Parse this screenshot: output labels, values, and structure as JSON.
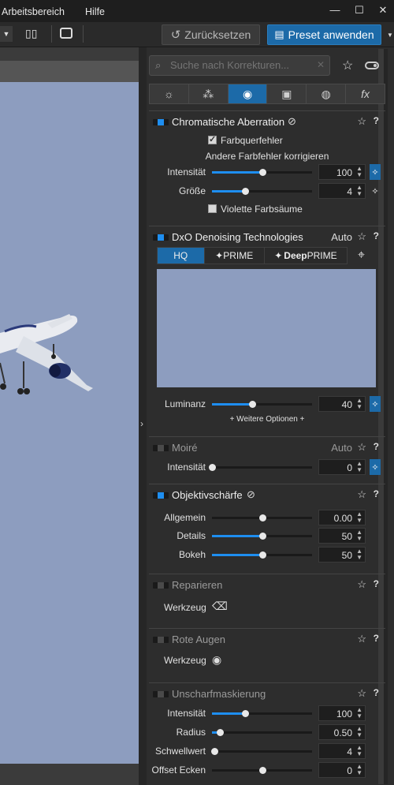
{
  "menubar": {
    "items": [
      "Arbeitsbereich",
      "Hilfe"
    ],
    "win": [
      "—",
      "☐",
      "✕"
    ]
  },
  "toolbar": {
    "reset_label": "Zurücksetzen",
    "preset_label": "Preset anwenden"
  },
  "search": {
    "placeholder": "Suche nach Korrekturen..."
  },
  "tabs": [
    "☼",
    "⁂",
    "◉",
    "▣",
    "◍",
    "fx"
  ],
  "sections": {
    "ca": {
      "title": "Chromatische Aberration",
      "checkbox1": "Farbquerfehler",
      "subheading": "Andere Farbfehler korrigieren",
      "rows": [
        {
          "label": "Intensität",
          "value": "100",
          "level": 0.5
        },
        {
          "label": "Größe",
          "value": "4",
          "level": 0.33
        }
      ],
      "checkbox2": "Violette Farbsäume"
    },
    "denoise": {
      "title": "DxO Denoising Technologies",
      "auto": "Auto",
      "tab_hq": "HQ",
      "tab_prime": "✦PRIME",
      "tab_deep1": "Deep",
      "tab_deep2": "PRIME",
      "luminance_label": "Luminanz",
      "luminance_value": "40",
      "luminance_level": 0.4,
      "more": "+ Weitere Optionen +"
    },
    "moire": {
      "title": "Moiré",
      "auto": "Auto",
      "label": "Intensität",
      "value": "0",
      "level": 0
    },
    "sharp": {
      "title": "Objektivschärfe",
      "rows": [
        {
          "label": "Allgemein",
          "value": "0.00",
          "level": 0.5,
          "filled": false
        },
        {
          "label": "Details",
          "value": "50",
          "level": 0.5,
          "filled": true
        },
        {
          "label": "Bokeh",
          "value": "50",
          "level": 0.5,
          "filled": true
        }
      ]
    },
    "repair": {
      "title": "Reparieren",
      "tool": "Werkzeug"
    },
    "redeye": {
      "title": "Rote Augen",
      "tool": "Werkzeug"
    },
    "unsharp": {
      "title": "Unscharfmaskierung",
      "rows": [
        {
          "label": "Intensität",
          "value": "100",
          "level": 0.33
        },
        {
          "label": "Radius",
          "value": "0.50",
          "level": 0.08
        },
        {
          "label": "Schwellwert",
          "value": "4",
          "level": 0.02
        },
        {
          "label": "Offset Ecken",
          "value": "0",
          "level": 0.5,
          "filled": false
        }
      ]
    }
  },
  "colors": {
    "accent": "#1e8ef0",
    "active_tab": "#1c6aa8",
    "sky": "#8d9dbf"
  }
}
